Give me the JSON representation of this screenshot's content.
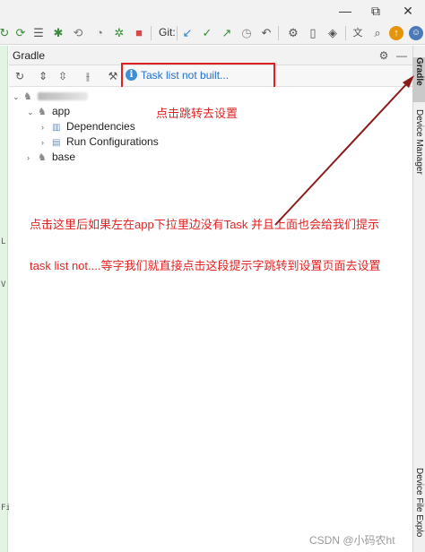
{
  "toolbar": {
    "git_label": "Git:",
    "icons": [
      "resync-icon",
      "sync-run-icon",
      "list-icon",
      "bug-icon",
      "attach-debugger-icon",
      "profile-icon",
      "debug-icon",
      "stop-icon",
      "git-update-icon",
      "git-commit-icon",
      "git-push-icon",
      "git-history-icon",
      "git-rollback-icon",
      "device-manager-icon",
      "sdk-manager-icon",
      "translate-icon",
      "search-icon",
      "update-icon",
      "avatar-icon"
    ]
  },
  "window": {
    "minimize": "—",
    "restore": "⧉"
  },
  "left_strip": {
    "chars": [
      "L",
      "V",
      "Fi"
    ]
  },
  "gradle_panel": {
    "title": "Gradle",
    "task_list_link": "Task list not built...",
    "tree": {
      "root_label": "",
      "items": [
        {
          "label": "app",
          "expanded": true
        },
        {
          "label": "Dependencies",
          "expanded": false
        },
        {
          "label": "Run Configurations",
          "expanded": false
        },
        {
          "label": "base",
          "expanded": false
        }
      ]
    }
  },
  "annotations": {
    "goto_settings": "点击跳转去设置",
    "line1": "点击这里后如果左在app下拉里边没有Task 并且上面也会给我们提示",
    "line2": "task list not....等字我们就直接点击这段提示字跳转到设置页面去设置"
  },
  "right_tabs": {
    "gradle": "Gradle",
    "device_manager": "Device Manager",
    "device_file_explorer": "Device File Explo"
  },
  "watermark": "CSDN @小码农ht",
  "colors": {
    "accent_red": "#e02424",
    "link_blue": "#2470c9",
    "arrow_dark_red": "#8b1a1a"
  }
}
